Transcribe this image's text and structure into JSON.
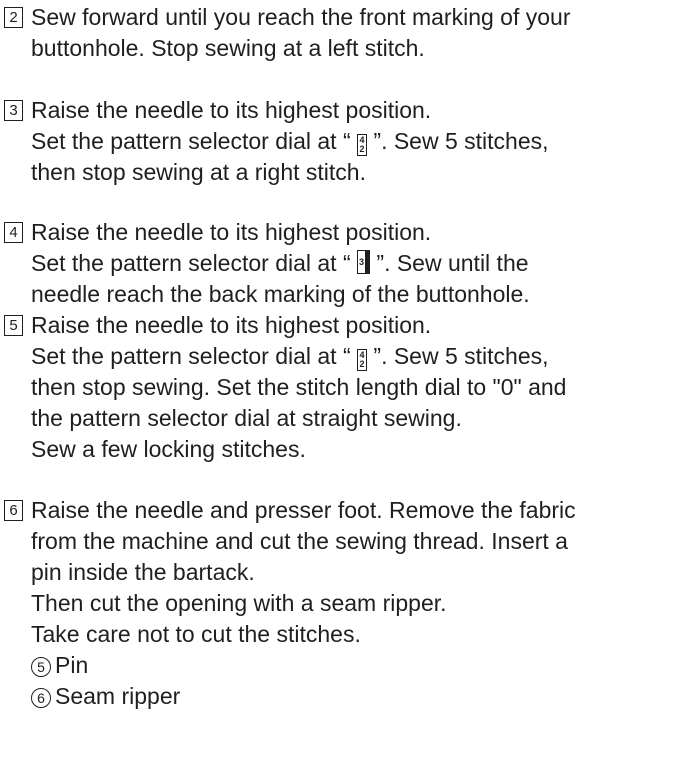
{
  "steps": [
    {
      "num": "2",
      "lines": [
        "Sew forward until you reach the front marking of your",
        "buttonhole. Stop sewing at a left stitch."
      ]
    },
    {
      "num": "3",
      "l1": "Raise the needle to its highest position.",
      "l2a": "Set the pattern selector dial at “",
      "l2b": "”. Sew 5 stitches,",
      "l3": "then stop sewing at a right stitch."
    },
    {
      "num": "4",
      "l1": "Raise the needle to its highest position.",
      "l2a": "Set the pattern selector dial at “",
      "l2b": "”. Sew until the",
      "l3": "needle reach the back marking of the buttonhole."
    },
    {
      "num": "5",
      "l1": "Raise the needle to its highest position.",
      "l2a": "Set the pattern selector dial at “",
      "l2b": "”. Sew 5 stitches,",
      "l3": "then stop sewing. Set the stitch length dial to \"0\" and",
      "l4": "the pattern selector dial at straight sewing.",
      "l5": "Sew a few locking stitches."
    },
    {
      "num": "6",
      "lines": [
        "Raise the needle and presser foot. Remove the fabric",
        "from the machine and cut the sewing thread. Insert a",
        "pin inside the bartack.",
        "Then cut the opening with a seam ripper.",
        "Take care not to cut the stitches."
      ],
      "refs": [
        {
          "mark": "5",
          "label": "Pin"
        },
        {
          "mark": "6",
          "label": "Seam ripper"
        }
      ]
    }
  ],
  "symbols": {
    "bartack": {
      "top": "4",
      "bottom": "2"
    },
    "left_side": "3"
  }
}
